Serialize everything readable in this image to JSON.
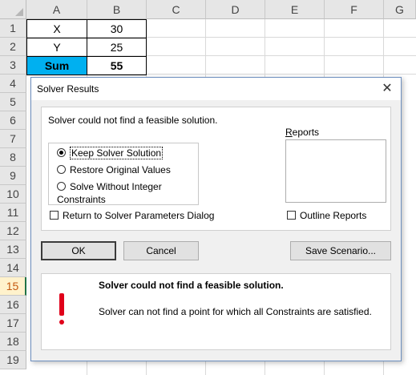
{
  "spreadsheet": {
    "columns": [
      "A",
      "B",
      "C",
      "D",
      "E",
      "F",
      "G"
    ],
    "rows": [
      "1",
      "2",
      "3",
      "4",
      "5",
      "6",
      "7",
      "8",
      "9",
      "10",
      "11",
      "12",
      "13",
      "14",
      "15",
      "16",
      "17",
      "18",
      "19"
    ],
    "selected_row": "15",
    "cells": {
      "a1": "X",
      "b1": "30",
      "a2": "Y",
      "b2": "25",
      "a3": "Sum",
      "b3": "55"
    },
    "sum_fill_color": "#00b0f0"
  },
  "dialog": {
    "title": "Solver Results",
    "close_icon": "close-icon",
    "message": "Solver could not find a feasible solution.",
    "reports_label": "Reports",
    "options": [
      {
        "label": "Keep Solver Solution",
        "selected": true
      },
      {
        "label": "Restore Original Values",
        "selected": false
      },
      {
        "label": "Solve Without Integer Constraints",
        "selected": false
      }
    ],
    "return_checkbox_label": "Return to Solver Parameters Dialog",
    "outline_checkbox_label": "Outline Reports",
    "buttons": {
      "ok": "OK",
      "cancel": "Cancel",
      "save_scenario": "Save Scenario..."
    },
    "info": {
      "icon": "exclamation-icon",
      "icon_color": "#e0001a",
      "title": "Solver could not find a feasible solution.",
      "body": "Solver can not find a point for which all Constraints are satisfied."
    }
  }
}
